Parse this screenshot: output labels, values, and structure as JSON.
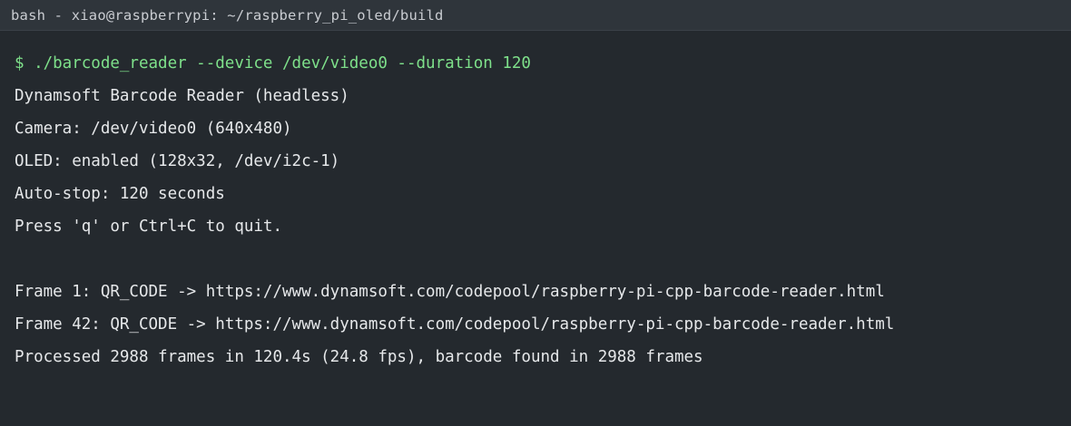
{
  "window": {
    "title": "bash - xiao@raspberrypi: ~/raspberry_pi_oled/build"
  },
  "terminal": {
    "command": "$ ./barcode_reader --device /dev/video0 --duration 120",
    "lines": [
      "Dynamsoft Barcode Reader (headless)",
      "Camera: /dev/video0 (640x480)",
      "OLED: enabled (128x32, /dev/i2c-1)",
      "Auto-stop: 120 seconds",
      "Press 'q' or Ctrl+C to quit.",
      "",
      "Frame 1: QR_CODE -> https://www.dynamsoft.com/codepool/raspberry-pi-cpp-barcode-reader.html",
      "Frame 42: QR_CODE -> https://www.dynamsoft.com/codepool/raspberry-pi-cpp-barcode-reader.html",
      "Processed 2988 frames in 120.4s (24.8 fps), barcode found in 2988 frames"
    ]
  },
  "colors": {
    "background": "#24292e",
    "titlebar": "#2f353b",
    "text": "#e6e8ea",
    "prompt": "#7ee08a"
  }
}
